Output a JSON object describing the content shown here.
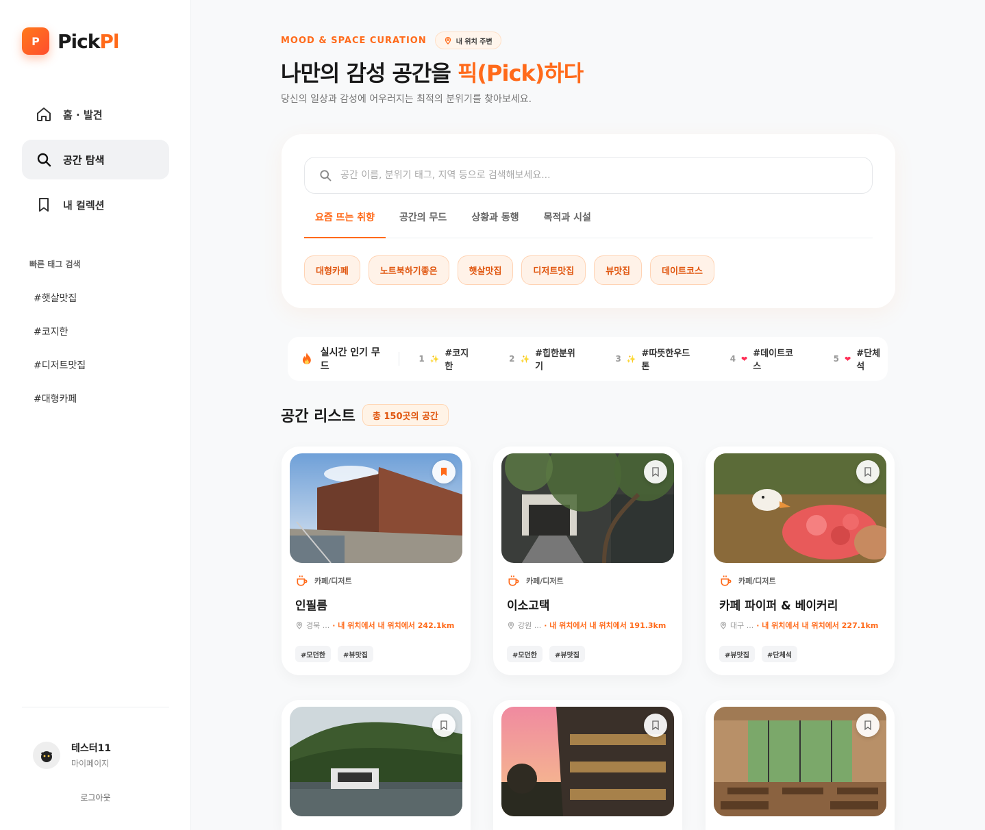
{
  "brand": {
    "mark": "P",
    "name_main": "Pick",
    "name_accent": "Pl"
  },
  "nav": [
    {
      "label": "홈 · 발견",
      "icon": "home-icon",
      "active": false
    },
    {
      "label": "공간 탐색",
      "icon": "search-icon",
      "active": true
    },
    {
      "label": "내 컬렉션",
      "icon": "bookmark-icon",
      "active": false
    }
  ],
  "quick_tags": {
    "title": "빠른 태그 검색",
    "items": [
      "#햇살맛집",
      "#코지한",
      "#디저트맛집",
      "#대형카페"
    ]
  },
  "profile": {
    "name": "테스터11",
    "sub": "마이페이지",
    "logout": "로그아웃"
  },
  "hero": {
    "eyebrow": "MOOD & SPACE CURATION",
    "location_badge": "내 위치 주변",
    "title_start": "나만의 감성 공간을 ",
    "title_accent": "픽(Pick)하다",
    "subtitle": "당신의 일상과 감성에 어우러지는 최적의 분위기를 찾아보세요."
  },
  "search": {
    "placeholder": "공간 이름, 분위기 태그, 지역 등으로 검색해보세요...",
    "tabs": [
      "요즘 뜨는 취향",
      "공간의 무드",
      "상황과 동행",
      "목적과 시설"
    ],
    "active_tab": 0,
    "chips": [
      "대형카페",
      "노트북하기좋은",
      "햇살맛집",
      "디저트맛집",
      "뷰맛집",
      "데이트코스"
    ]
  },
  "trending": {
    "label": "실시간 인기 무드",
    "items": [
      {
        "rank": "1",
        "icon": "✨",
        "tag": "#코지한"
      },
      {
        "rank": "2",
        "icon": "✨",
        "tag": "#힙한분위기"
      },
      {
        "rank": "3",
        "icon": "✨",
        "tag": "#따뜻한우드톤"
      },
      {
        "rank": "4",
        "icon": "❤",
        "tag": "#데이트코스"
      },
      {
        "rank": "5",
        "icon": "❤",
        "tag": "#단체석"
      }
    ]
  },
  "list": {
    "title": "공간 리스트",
    "count": "총 150곳의 공간",
    "cards": [
      {
        "category": "카페/디저트",
        "name": "인필름",
        "region": "경북 ...",
        "distance": "· 내 위치에서 내 위치에서 242.1km",
        "tags": [
          "#모던한",
          "#뷰맛집"
        ],
        "bookmarked": true,
        "image": "brick-building"
      },
      {
        "category": "카페/디저트",
        "name": "이소고택",
        "region": "강원 ...",
        "distance": "· 내 위치에서 내 위치에서 191.3km",
        "tags": [
          "#모던한",
          "#뷰맛집"
        ],
        "bookmarked": false,
        "image": "tree-courtyard"
      },
      {
        "category": "카페/디저트",
        "name": "카페 파이퍼 & 베이커리",
        "region": "대구 ...",
        "distance": "· 내 위치에서 내 위치에서 227.1km",
        "tags": [
          "#뷰맛집",
          "#단체석"
        ],
        "bookmarked": false,
        "image": "bingsu-dessert"
      },
      {
        "image": "mountain-pool",
        "bookmarked": false
      },
      {
        "image": "sunset-facade",
        "bookmarked": false
      },
      {
        "image": "wood-hall",
        "bookmarked": false
      }
    ]
  },
  "colors": {
    "accent": "#ff6a1a",
    "accent_end": "#ff3d5a",
    "chip_bg": "#fff2e8"
  }
}
